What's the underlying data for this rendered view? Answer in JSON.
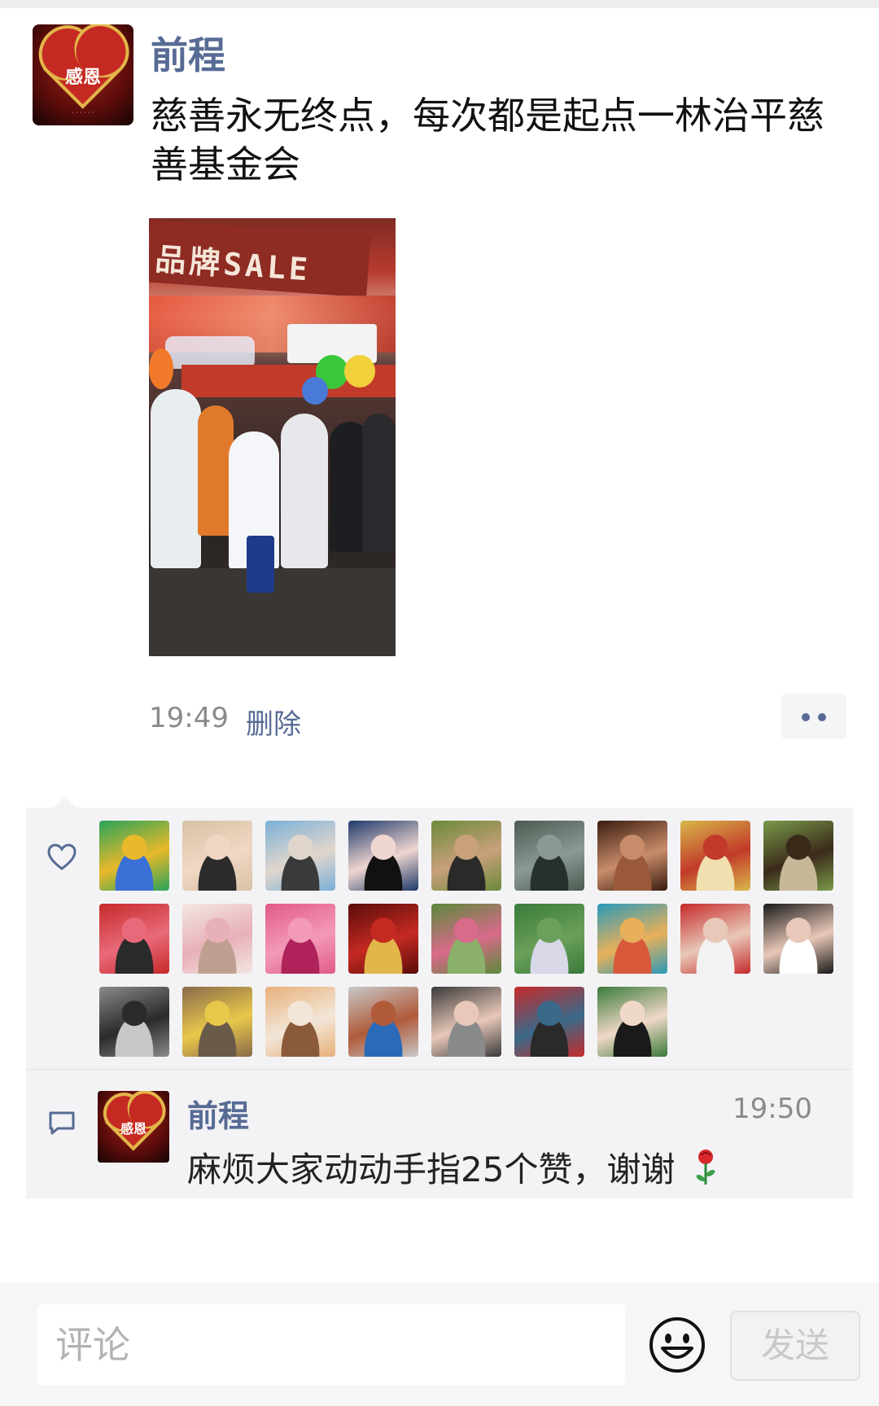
{
  "post": {
    "author": "前程",
    "avatar_text": "感恩",
    "text": "慈善永无终点，每次都是起点一林治平慈善基金会",
    "photo_banner_text": "品牌SALE",
    "time": "19:49",
    "delete_label": "删除"
  },
  "likes": {
    "icon": "heart-outline-icon",
    "avatars": [
      {
        "name": "peacock",
        "colors": [
          "#2aa35a",
          "#e8b92a",
          "#3a6fd6"
        ]
      },
      {
        "name": "woman-hat",
        "colors": [
          "#d8c2a4",
          "#f1d7c4",
          "#2b2b2b"
        ]
      },
      {
        "name": "woman-sunglasses",
        "colors": [
          "#7bb0d8",
          "#e0d6cc",
          "#3a3a3a"
        ]
      },
      {
        "name": "woman-portrait",
        "colors": [
          "#1f3a6b",
          "#efd6d0",
          "#111111"
        ]
      },
      {
        "name": "man-outdoor",
        "colors": [
          "#6b8a3a",
          "#c8a07a",
          "#2a2a2a"
        ]
      },
      {
        "name": "mountains",
        "colors": [
          "#4c5a52",
          "#8a9a92",
          "#26302c"
        ]
      },
      {
        "name": "elderly-man",
        "colors": [
          "#3a1c10",
          "#c88c6a",
          "#9a5a3a"
        ]
      },
      {
        "name": "puppies",
        "colors": [
          "#d8b84a",
          "#c23a2a",
          "#f0e0b0"
        ]
      },
      {
        "name": "child-grass",
        "colors": [
          "#7a9a4a",
          "#3a2a1a",
          "#c8b89a"
        ]
      },
      {
        "name": "boy-red",
        "colors": [
          "#c62a2a",
          "#e86a7a",
          "#2a2a2a"
        ]
      },
      {
        "name": "baby-frame",
        "colors": [
          "#f2e6e0",
          "#e8b0b8",
          "#bfa090"
        ]
      },
      {
        "name": "pink-rose",
        "colors": [
          "#e25a8a",
          "#f39ab8",
          "#b0225a"
        ]
      },
      {
        "name": "heart-badge",
        "colors": [
          "#5a0c0a",
          "#c52a22",
          "#e2b64a"
        ]
      },
      {
        "name": "flower-field",
        "colors": [
          "#5a8a3a",
          "#d86a8a",
          "#8ab06a"
        ]
      },
      {
        "name": "woman-garden",
        "colors": [
          "#3a7a3a",
          "#6aa05a",
          "#d8d8e8"
        ]
      },
      {
        "name": "coastal-town",
        "colors": [
          "#2a9ab8",
          "#e8b05a",
          "#d8583a"
        ]
      },
      {
        "name": "family-children",
        "colors": [
          "#c62a2a",
          "#e8c8b8",
          "#f2f2f2"
        ]
      },
      {
        "name": "woman-closeup",
        "colors": [
          "#1a1a1a",
          "#e8c8b8",
          "#ffffff"
        ]
      },
      {
        "name": "silhouettes",
        "colors": [
          "#8a8a8a",
          "#2a2a2a",
          "#c8c8c8"
        ]
      },
      {
        "name": "statue-child",
        "colors": [
          "#8a6a4a",
          "#e8c84a",
          "#6a5a4a"
        ]
      },
      {
        "name": "shiba-dog",
        "colors": [
          "#e8b07a",
          "#f2e6d8",
          "#8a5a3a"
        ]
      },
      {
        "name": "track-child",
        "colors": [
          "#c8c8c8",
          "#b05a3a",
          "#2a6ab8"
        ]
      },
      {
        "name": "woman-dark",
        "colors": [
          "#3a3a3a",
          "#e8c8b8",
          "#8a8a8a"
        ]
      },
      {
        "name": "red-flowers",
        "colors": [
          "#c62a2a",
          "#3a6a8a",
          "#2a2a2a"
        ]
      },
      {
        "name": "woman-cap",
        "colors": [
          "#3a7a3a",
          "#f0d8c8",
          "#1a1a1a"
        ]
      }
    ]
  },
  "comment": {
    "icon": "comment-bubble-icon",
    "author": "前程",
    "avatar_text": "感恩",
    "time": "19:50",
    "text": "麻烦大家动动手指25个赞，谢谢",
    "trailing_icon": "rose-icon"
  },
  "input_bar": {
    "placeholder": "评论",
    "emoji_icon": "smiley-icon",
    "send_label": "发送"
  }
}
